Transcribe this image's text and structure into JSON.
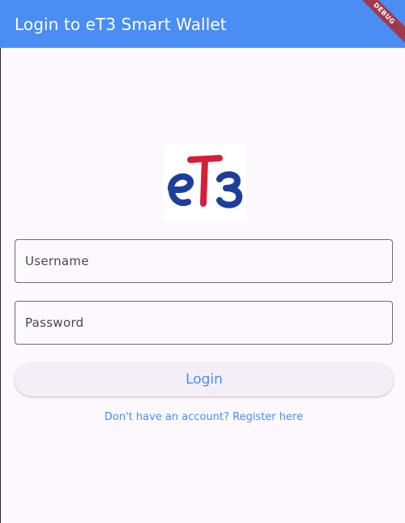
{
  "app_bar": {
    "title": "Login to eT3 Smart Wallet",
    "debug_banner": "DEBUG"
  },
  "logo": {
    "text_e": "e",
    "text_t": "T",
    "text_3": "3",
    "color_e3": "#1d3f9c",
    "color_t": "#d51f3a"
  },
  "form": {
    "username_placeholder": "Username",
    "username_value": "",
    "password_placeholder": "Password",
    "password_value": "",
    "login_label": "Login",
    "register_link": "Don't have an account? Register here"
  },
  "colors": {
    "app_bar": "#4a8df3",
    "accent": "#4a8df3",
    "background": "#fdf8fd"
  }
}
